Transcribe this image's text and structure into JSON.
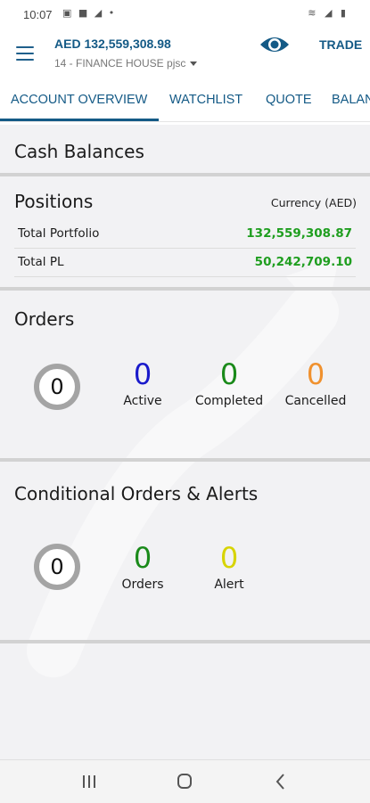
{
  "status_bar": {
    "time": "10:07",
    "left_icons": "▣ ■ ◢ •",
    "right_icons": "≋ ◢ ▮"
  },
  "header": {
    "balance": "AED 132,559,308.98",
    "account": "14 - FINANCE HOUSE pjsc",
    "trade_label": "TRADE"
  },
  "tabs": [
    {
      "label": "ACCOUNT OVERVIEW",
      "active": true
    },
    {
      "label": "WATCHLIST"
    },
    {
      "label": "QUOTE"
    },
    {
      "label": "BALANCES"
    }
  ],
  "cash": {
    "title": "Cash Balances"
  },
  "positions": {
    "title": "Positions",
    "currency_label": "Currency (AED)",
    "rows": [
      {
        "label": "Total Portfolio",
        "value": "132,559,308.87"
      },
      {
        "label": "Total PL",
        "value": "50,242,709.10"
      }
    ]
  },
  "orders": {
    "title": "Orders",
    "total": "0",
    "stats": [
      {
        "value": "0",
        "label": "Active",
        "color": "#1a1acb"
      },
      {
        "value": "0",
        "label": "Completed",
        "color": "#1a8a1a"
      },
      {
        "value": "0",
        "label": "Cancelled",
        "color": "#f0912e"
      }
    ]
  },
  "conditional": {
    "title": "Conditional Orders & Alerts",
    "total": "0",
    "stats": [
      {
        "value": "0",
        "label": "Orders",
        "color": "#1a8a1a"
      },
      {
        "value": "0",
        "label": "Alert",
        "color": "#d7d400"
      }
    ]
  },
  "colors": {
    "brand": "#145a86",
    "positive": "#1f9e1f",
    "ring": "#a4a4a4"
  },
  "nav_icons": [
    "recent-apps-icon",
    "home-icon",
    "back-icon"
  ]
}
